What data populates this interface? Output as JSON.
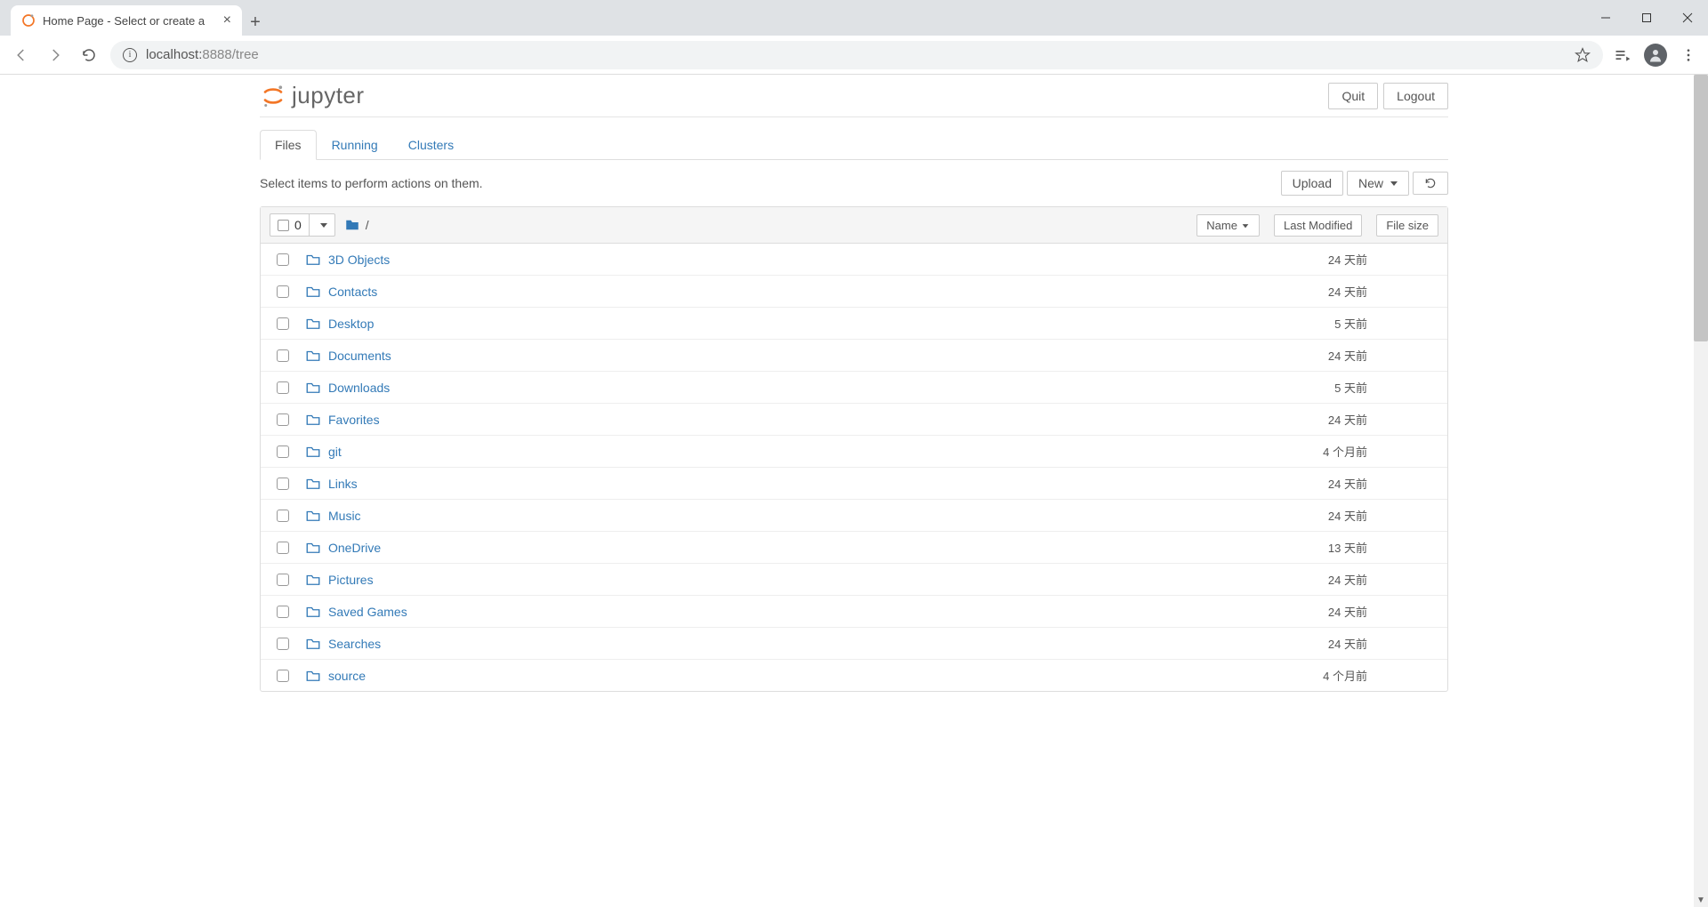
{
  "browser": {
    "tab_title": "Home Page - Select or create a",
    "url_host": "localhost:",
    "url_rest": "8888/tree"
  },
  "header": {
    "logo_text": "jupyter",
    "quit": "Quit",
    "logout": "Logout"
  },
  "tabs": {
    "files": "Files",
    "running": "Running",
    "clusters": "Clusters"
  },
  "toolbar": {
    "note": "Select items to perform actions on them.",
    "upload": "Upload",
    "new": "New"
  },
  "list_header": {
    "selected_count": "0",
    "breadcrumb_root": "/",
    "name": "Name",
    "last_modified": "Last Modified",
    "file_size": "File size"
  },
  "rows": [
    {
      "name": "3D Objects",
      "modified": "24 天前",
      "size": ""
    },
    {
      "name": "Contacts",
      "modified": "24 天前",
      "size": ""
    },
    {
      "name": "Desktop",
      "modified": "5 天前",
      "size": ""
    },
    {
      "name": "Documents",
      "modified": "24 天前",
      "size": ""
    },
    {
      "name": "Downloads",
      "modified": "5 天前",
      "size": ""
    },
    {
      "name": "Favorites",
      "modified": "24 天前",
      "size": ""
    },
    {
      "name": "git",
      "modified": "4 个月前",
      "size": ""
    },
    {
      "name": "Links",
      "modified": "24 天前",
      "size": ""
    },
    {
      "name": "Music",
      "modified": "24 天前",
      "size": ""
    },
    {
      "name": "OneDrive",
      "modified": "13 天前",
      "size": ""
    },
    {
      "name": "Pictures",
      "modified": "24 天前",
      "size": ""
    },
    {
      "name": "Saved Games",
      "modified": "24 天前",
      "size": ""
    },
    {
      "name": "Searches",
      "modified": "24 天前",
      "size": ""
    },
    {
      "name": "source",
      "modified": "4 个月前",
      "size": ""
    }
  ]
}
